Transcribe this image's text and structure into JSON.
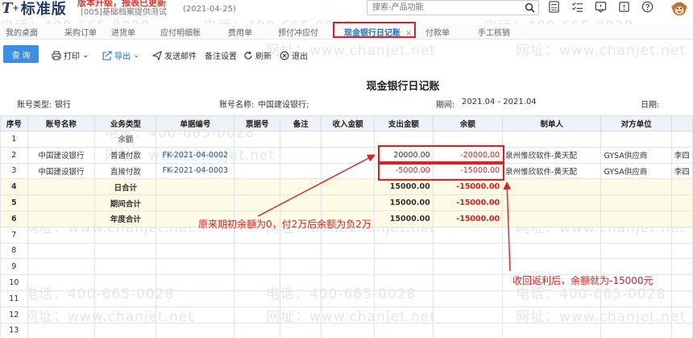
{
  "header": {
    "logo_mark": "T",
    "logo_plus": "+",
    "logo_name": "标准版",
    "top_notice": "版本升级，报表已更新",
    "account": "[005]基础档案提供测试",
    "account_date": "(2021-04-25)",
    "search_placeholder": "搜索-产品功能"
  },
  "watermarks": {
    "phone": "电话：400-665-0028",
    "site": "网址：www.chanjet.net"
  },
  "tabs": [
    {
      "label": "我的桌面"
    },
    {
      "label": "采购订单"
    },
    {
      "label": "进货单"
    },
    {
      "label": "应付明细账"
    },
    {
      "label": "费用单"
    },
    {
      "label": "预付冲应付"
    },
    {
      "label": "现金银行日记账",
      "active": true,
      "close": "×"
    },
    {
      "label": "付款单"
    },
    {
      "label": "手工核销"
    }
  ],
  "toolbar": {
    "query": "查 询",
    "print": "打印",
    "export": "导出",
    "send_mail": "发送邮件",
    "note_settings": "备注设置",
    "refresh": "刷新",
    "exit": "退出"
  },
  "report": {
    "title": "现金银行日记账",
    "account_type_label": "账号类型:",
    "account_type_value": "银行",
    "account_name_label": "账号名称:",
    "account_name_value": "中国建设银行;",
    "period_label": "期间:",
    "period_value": "2021.04 - 2021.04",
    "date_label": "日期:"
  },
  "table": {
    "headers": [
      "序号",
      "账号名称",
      "业务类型",
      "单据编号",
      "票据号",
      "备注",
      "收入金额",
      "支出金额",
      "余额",
      "制单人",
      "对方单位",
      ""
    ],
    "rows": [
      {
        "idx": "1",
        "cells": [
          "",
          "余额",
          "",
          "",
          "",
          "",
          "",
          "",
          "",
          "",
          ""
        ]
      },
      {
        "idx": "2",
        "cells": [
          "中国建设银行",
          "普通付款",
          "FK-2021-04-0002",
          "",
          "",
          "",
          "20000.00",
          "-20000.00",
          "泉州惟欣软件-黄天配",
          "GYSA供应商",
          "李四"
        ]
      },
      {
        "idx": "3",
        "cells": [
          "中国建设银行",
          "直接付款",
          "FK-2021-04-0003",
          "",
          "",
          "",
          "-5000.00",
          "-15000.00",
          "泉州惟欣软件-黄天配",
          "GYSA供应商",
          "李四"
        ]
      },
      {
        "idx": "4",
        "sum": true,
        "cells": [
          "",
          "日合计",
          "",
          "",
          "",
          "",
          "15000.00",
          "-15000.00",
          "",
          "",
          ""
        ]
      },
      {
        "idx": "5",
        "sum": true,
        "cells": [
          "",
          "期间合计",
          "",
          "",
          "",
          "",
          "15000.00",
          "-15000.00",
          "",
          "",
          ""
        ]
      },
      {
        "idx": "6",
        "sum": true,
        "cells": [
          "",
          "年度合计",
          "",
          "",
          "",
          "",
          "15000.00",
          "-15000.00",
          "",
          "",
          ""
        ]
      },
      {
        "idx": "7",
        "cells": [
          "",
          "",
          "",
          "",
          "",
          "",
          "",
          "",
          "",
          "",
          ""
        ]
      },
      {
        "idx": "8",
        "cells": [
          "",
          "",
          "",
          "",
          "",
          "",
          "",
          "",
          "",
          "",
          ""
        ]
      },
      {
        "idx": "9",
        "cells": [
          "",
          "",
          "",
          "",
          "",
          "",
          "",
          "",
          "",
          "",
          ""
        ]
      },
      {
        "idx": "10",
        "cells": [
          "",
          "",
          "",
          "",
          "",
          "",
          "",
          "",
          "",
          "",
          ""
        ]
      },
      {
        "idx": "11",
        "cells": [
          "",
          "",
          "",
          "",
          "",
          "",
          "",
          "",
          "",
          "",
          ""
        ]
      },
      {
        "idx": "12",
        "cells": [
          "",
          "",
          "",
          "",
          "",
          "",
          "",
          "",
          "",
          "",
          ""
        ]
      },
      {
        "idx": "13",
        "cells": [
          "",
          "",
          "",
          "",
          "",
          "",
          "",
          "",
          "",
          "",
          ""
        ]
      }
    ]
  },
  "annotations": {
    "note1": "原来期初余额为0，付2万后余额为负2万",
    "note2": "收回返利后，余额就为-15000元",
    "color": "#e02020"
  }
}
